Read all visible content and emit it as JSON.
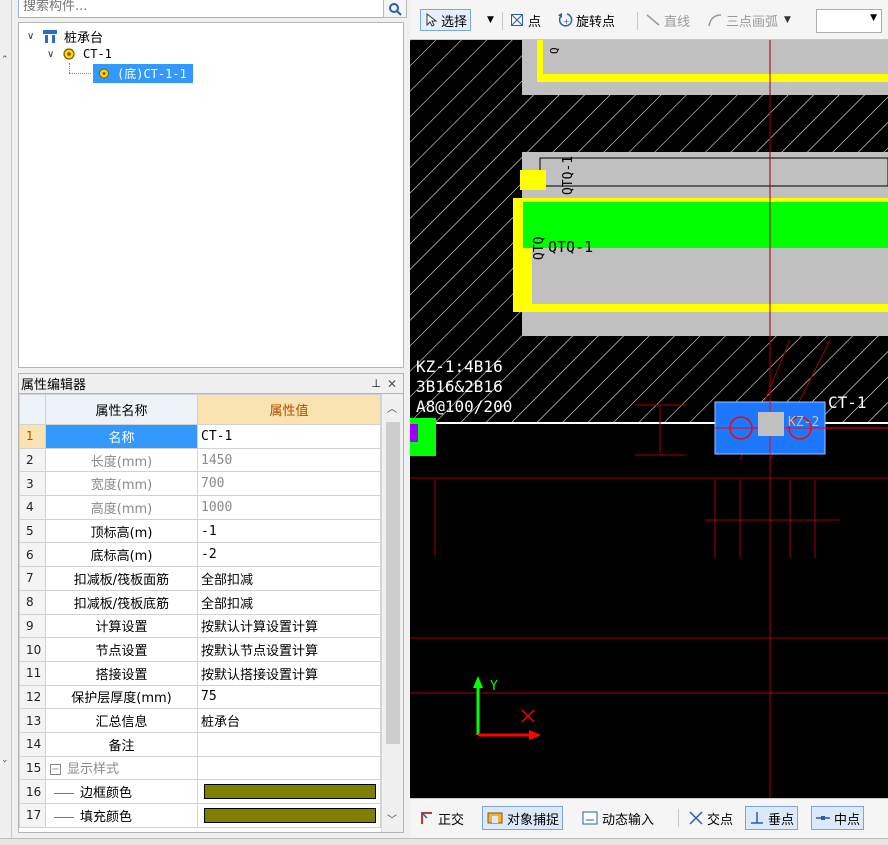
{
  "search": {
    "placeholder": "搜索构件..."
  },
  "tree": {
    "root": "桩承台",
    "child": "CT-1",
    "leaf": "(底)CT-1-1"
  },
  "prop_editor": {
    "title": "属性编辑器",
    "col_name": "属性名称",
    "col_value": "属性值",
    "rows": [
      {
        "n": "1",
        "name": "名称",
        "value": "CT-1"
      },
      {
        "n": "2",
        "name": "长度(mm)",
        "value": "1450"
      },
      {
        "n": "3",
        "name": "宽度(mm)",
        "value": "700"
      },
      {
        "n": "4",
        "name": "高度(mm)",
        "value": "1000"
      },
      {
        "n": "5",
        "name": "顶标高(m)",
        "value": "-1"
      },
      {
        "n": "6",
        "name": "底标高(m)",
        "value": "-2"
      },
      {
        "n": "7",
        "name": "扣减板/筏板面筋",
        "value": "全部扣减"
      },
      {
        "n": "8",
        "name": "扣减板/筏板底筋",
        "value": "全部扣减"
      },
      {
        "n": "9",
        "name": "计算设置",
        "value": "按默认计算设置计算"
      },
      {
        "n": "10",
        "name": "节点设置",
        "value": "按默认节点设置计算"
      },
      {
        "n": "11",
        "name": "搭接设置",
        "value": "按默认搭接设置计算"
      },
      {
        "n": "12",
        "name": "保护层厚度(mm)",
        "value": "75"
      },
      {
        "n": "13",
        "name": "汇总信息",
        "value": "桩承台"
      },
      {
        "n": "14",
        "name": "备注",
        "value": ""
      },
      {
        "n": "15",
        "name": "显示样式",
        "value": ""
      },
      {
        "n": "16",
        "name": "边框颜色",
        "value": ""
      },
      {
        "n": "17",
        "name": "填充颜色",
        "value": ""
      }
    ],
    "swatch_color": "#808000"
  },
  "toolbar": {
    "select": "选择",
    "point": "点",
    "rotate_point": "旋转点",
    "line": "直线",
    "arc": "三点画弧"
  },
  "cad": {
    "qtq1": "QTQ-1",
    "label_kz1": "KZ-1:4B16",
    "label_3b": "3B16&2B16",
    "label_a8": "A8@100/200",
    "label_ct1": "CT-1",
    "label_kz2": "KZ-2",
    "axis_y": "Y",
    "axis_x": "X",
    "colors": {
      "yellow": "#ffff00",
      "green": "#00ff00",
      "gray": "#c0c0c0",
      "blue": "#1e78ff",
      "red": "#ff0000",
      "darkred": "#a00000"
    }
  },
  "statusbar": {
    "ortho": "正交",
    "snap": "对象捕捉",
    "dynamic": "动态输入",
    "intersect": "交点",
    "perp": "垂点",
    "mid": "中点"
  }
}
